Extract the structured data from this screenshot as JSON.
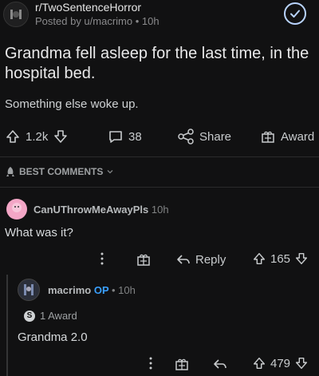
{
  "post": {
    "subreddit": "r/TwoSentenceHorror",
    "meta": "Posted by u/macrimo • 10h",
    "title": "Grandma fell asleep for the last time, in the hospital bed.",
    "body": "Something else woke up.",
    "upvotes": "1.2k",
    "comments": "38",
    "share_label": "Share",
    "award_label": "Award"
  },
  "comments_header": {
    "label": "BEST COMMENTS"
  },
  "comment": {
    "username": "CanUThrowMeAwayPls",
    "time": "10h",
    "body": "What was it?",
    "reply_label": "Reply",
    "score": "165"
  },
  "reply": {
    "username": "macrimo",
    "op_label": "OP",
    "time": "• 10h",
    "award_text": "1 Award",
    "body": "Grandma 2.0",
    "score": "479"
  },
  "colors": {
    "background": "#111112",
    "text": "#d7dadc",
    "muted": "#818384",
    "op": "#3aa0ff"
  }
}
